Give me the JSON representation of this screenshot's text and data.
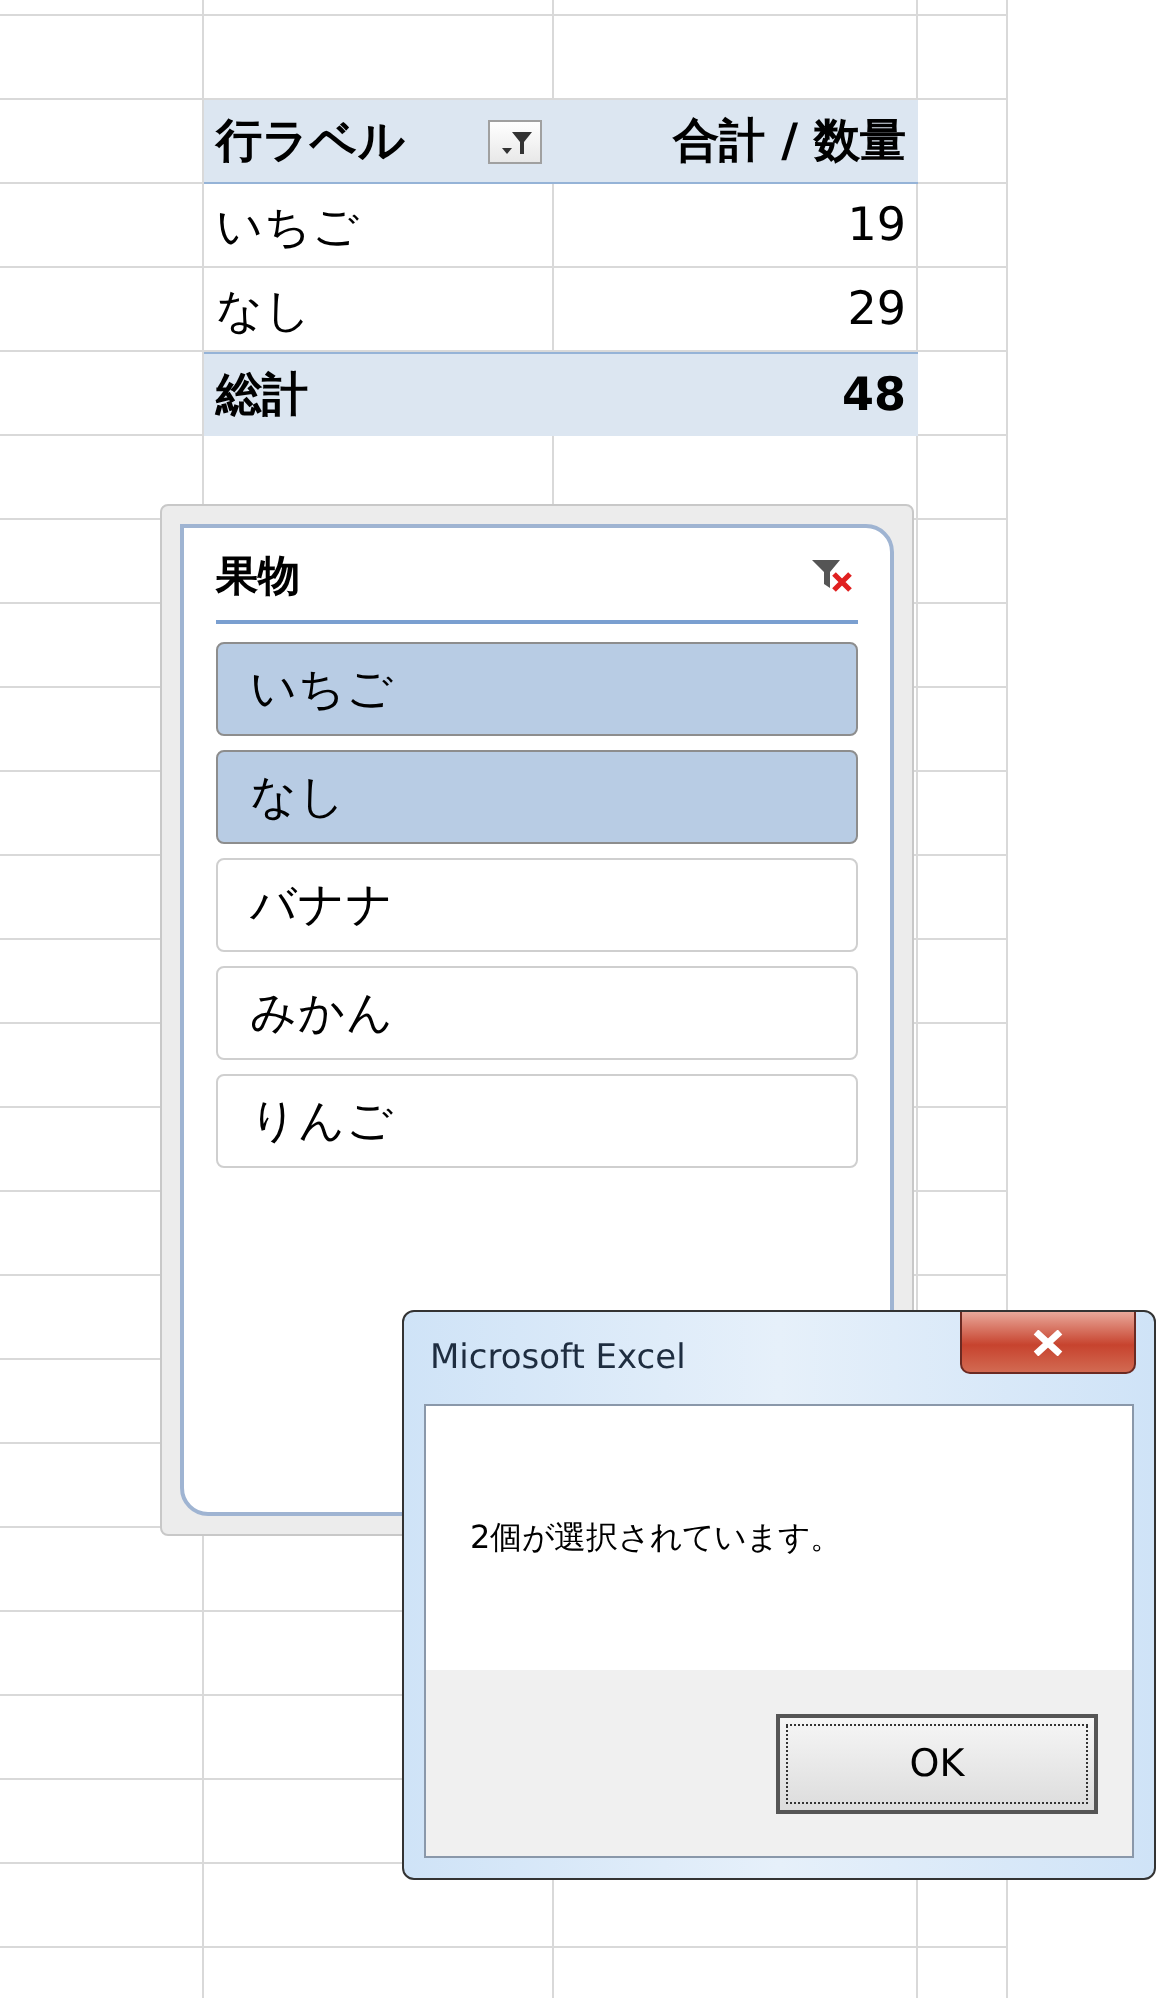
{
  "pivot_table": {
    "columns": [
      "行ラベル",
      "合計 / 数量"
    ],
    "rows": [
      {
        "label": "いちご",
        "value": "19"
      },
      {
        "label": "なし",
        "value": "29"
      }
    ],
    "total": {
      "label": "総計",
      "value": "48"
    }
  },
  "slicer": {
    "title": "果物",
    "items": [
      {
        "label": "いちご",
        "selected": true
      },
      {
        "label": "なし",
        "selected": true
      },
      {
        "label": "バナナ",
        "selected": false
      },
      {
        "label": "みかん",
        "selected": false
      },
      {
        "label": "りんご",
        "selected": false
      }
    ]
  },
  "dialog": {
    "title": "Microsoft Excel",
    "message": "2個が選択されています。",
    "buttons": [
      "OK"
    ]
  }
}
